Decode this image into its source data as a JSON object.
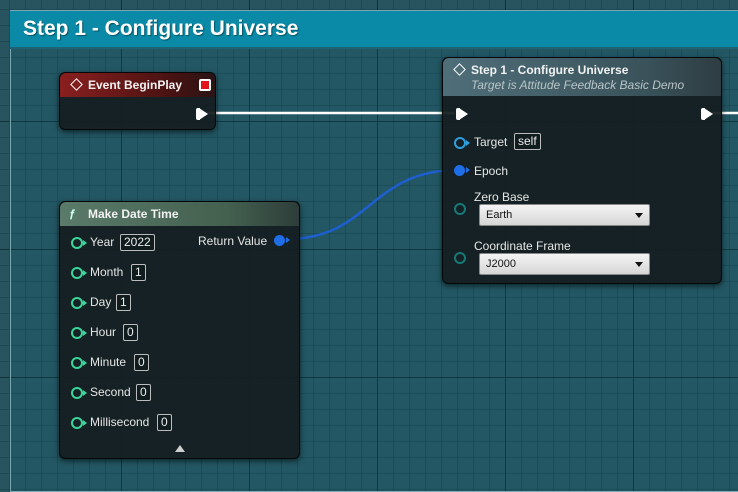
{
  "comment": {
    "title": "Step 1 - Configure Universe"
  },
  "begin_play": {
    "title": "Event BeginPlay"
  },
  "configure": {
    "title": "Step 1 - Configure Universe",
    "subtitle": "Target is Attitude Feedback Basic Demo",
    "pins": {
      "target_label": "Target",
      "target_value": "self",
      "epoch_label": "Epoch",
      "zero_base_label": "Zero Base",
      "zero_base_value": "Earth",
      "coord_frame_label": "Coordinate Frame",
      "coord_frame_value": "J2000"
    }
  },
  "make_date": {
    "title": "Make Date Time",
    "return_label": "Return Value",
    "fields": [
      {
        "label": "Year",
        "value": "2022"
      },
      {
        "label": "Month",
        "value": "1"
      },
      {
        "label": "Day",
        "value": "1"
      },
      {
        "label": "Hour",
        "value": "0"
      },
      {
        "label": "Minute",
        "value": "0"
      },
      {
        "label": "Second",
        "value": "0"
      },
      {
        "label": "Millisecond",
        "value": "0"
      }
    ]
  },
  "colors": {
    "comment_header": "#0a8aa6",
    "event_header": "#8a1f1f",
    "function_header": "#4f6e79",
    "pure_header": "#5a7a6a",
    "exec_wire": "#ffffff",
    "struct_wire": "#1e5fd0"
  }
}
